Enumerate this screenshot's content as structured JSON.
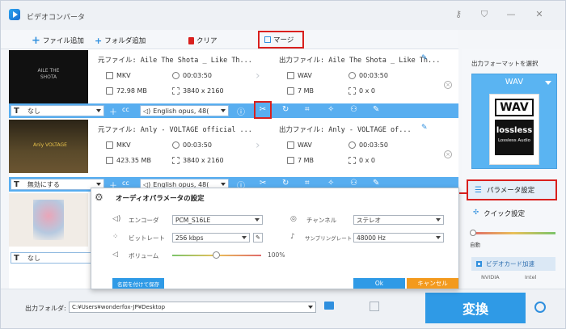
{
  "app": {
    "title": "ビデオコンバータ"
  },
  "toolbar": {
    "add_file": "ファイル追加",
    "add_folder": "フォルダ追加",
    "clear": "クリア",
    "merge": "マージ"
  },
  "rows": [
    {
      "source": "元ファイル: Aile The Shota _ Like Th...",
      "src_format": "MKV",
      "src_duration": "00:03:50",
      "src_size": "72.98 MB",
      "src_res": "3840 x 2160",
      "output": "出力ファイル: Aile The Shota _ Like Th...",
      "out_format": "WAV",
      "out_duration": "00:03:50",
      "out_size": "7 MB",
      "out_res": "0 x 0",
      "subtitle": "なし",
      "audio": "English opus, 48(",
      "thumb_text": "AILE THE SHOTA"
    },
    {
      "source": "元ファイル: Anly - VOLTAGE official ...",
      "src_format": "MKV",
      "src_duration": "00:03:50",
      "src_size": "423.35 MB",
      "src_res": "3840 x 2160",
      "output": "出力ファイル: Anly - VOLTAGE of...",
      "out_format": "WAV",
      "out_duration": "00:03:50",
      "out_size": "7 MB",
      "out_res": "0 x 0",
      "subtitle": "無効にする",
      "audio": "English opus, 48(",
      "thumb_text": "Anly VOLTAGE"
    },
    {
      "subtitle": "なし"
    }
  ],
  "right": {
    "format_label": "出力フォーマットを選択",
    "format": "WAV",
    "format_icon_text": "WAV",
    "lossless_text": "lossless",
    "lossless_sub": "Lossless Audio",
    "param_button": "パラメータ設定",
    "quick_setting": "クイック設定",
    "auto": "自動",
    "gpu_accel": "ビデオカード加速",
    "nvidia": "NVIDIA",
    "intel": "Intel"
  },
  "dialog": {
    "title": "オーディオパラメータの設定",
    "encoder_label": "エンコーダ",
    "encoder_value": "PCM_S16LE",
    "bitrate_label": "ビットレート",
    "bitrate_value": "256 kbps",
    "volume_label": "ボリューム",
    "volume_value": "100%",
    "channel_label": "チャンネル",
    "channel_value": "ステレオ",
    "samplerate_label": "サンプリングレート",
    "samplerate_value": "48000 Hz",
    "save_as": "名前を付けて保存",
    "ok": "Ok",
    "cancel": "キャンセル"
  },
  "bottom": {
    "output_folder_label": "出力フォルダ:",
    "output_folder_path": "C:¥Users¥wonderfox-JP¥Desktop",
    "convert": "変換"
  },
  "colors": {
    "accent": "#2f9ae6",
    "highlight": "#d9201e",
    "control_bar": "#58aef0",
    "cancel": "#f39a1e"
  }
}
